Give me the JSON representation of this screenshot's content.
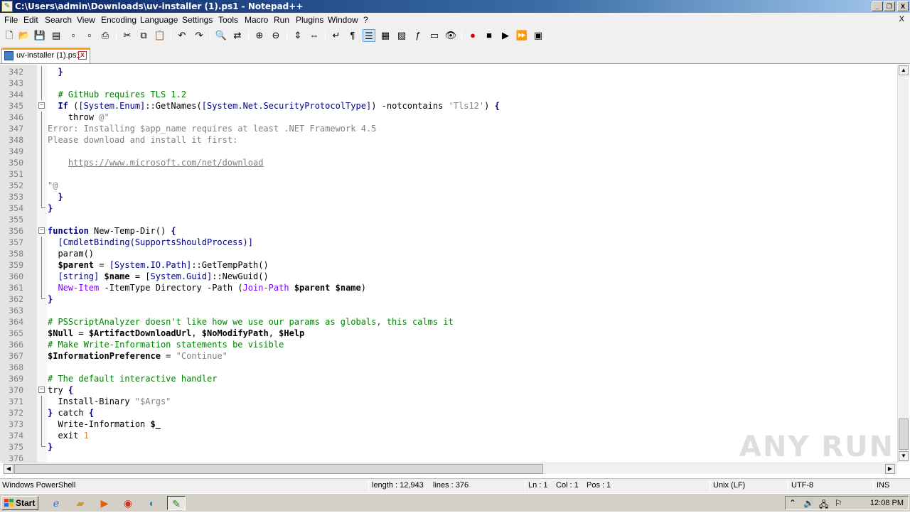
{
  "window": {
    "title": "C:\\Users\\admin\\Downloads\\uv-installer (1).ps1 - Notepad++",
    "min_label": "_",
    "max_label": "❐",
    "close_label": "X"
  },
  "menu": {
    "items": [
      "File",
      "Edit",
      "Search",
      "View",
      "Encoding",
      "Language",
      "Settings",
      "Tools",
      "Macro",
      "Run",
      "Plugins",
      "Window",
      "?"
    ],
    "close_label": "X"
  },
  "toolbar": {
    "icons": [
      "new-file-icon",
      "open-file-icon",
      "save-icon",
      "save-all-icon",
      "close-icon",
      "close-all-icon",
      "print-icon",
      "cut-icon",
      "copy-icon",
      "paste-icon",
      "undo-icon",
      "redo-icon",
      "find-icon",
      "replace-icon",
      "zoom-in-icon",
      "zoom-out-icon",
      "sync-vertical-icon",
      "sync-horizontal-icon",
      "word-wrap-icon",
      "show-all-chars-icon",
      "indent-guide-icon",
      "user-language-icon",
      "doc-map-icon",
      "function-list-icon",
      "folder-workspace-icon",
      "monitoring-icon",
      "record-macro-icon",
      "stop-macro-icon",
      "play-macro-icon",
      "run-macro-multiple-icon",
      "save-macro-icon"
    ]
  },
  "tab": {
    "label": "uv-installer (1).ps1",
    "close_label": "x"
  },
  "editor": {
    "lines": [
      {
        "n": "342",
        "fold": "line",
        "seg": [
          {
            "c": "plain",
            "t": "  "
          },
          {
            "c": "k",
            "t": "}"
          }
        ]
      },
      {
        "n": "343",
        "fold": "line",
        "seg": []
      },
      {
        "n": "344",
        "fold": "line",
        "seg": [
          {
            "c": "plain",
            "t": "  "
          },
          {
            "c": "cm",
            "t": "# GitHub requires TLS 1.2"
          }
        ]
      },
      {
        "n": "345",
        "fold": "box",
        "seg": [
          {
            "c": "plain",
            "t": "  "
          },
          {
            "c": "k",
            "t": "If"
          },
          {
            "c": "plain",
            "t": " ("
          },
          {
            "c": "typ",
            "t": "[System.Enum]"
          },
          {
            "c": "plain",
            "t": "::"
          },
          {
            "c": "plain",
            "t": "GetNames("
          },
          {
            "c": "typ",
            "t": "[System.Net.SecurityProtocolType]"
          },
          {
            "c": "plain",
            "t": ") -notcontains "
          },
          {
            "c": "str",
            "t": "'Tls12'"
          },
          {
            "c": "plain",
            "t": ") "
          },
          {
            "c": "k",
            "t": "{"
          }
        ]
      },
      {
        "n": "346",
        "fold": "line",
        "seg": [
          {
            "c": "plain",
            "t": "    throw "
          },
          {
            "c": "str",
            "t": "@\""
          }
        ]
      },
      {
        "n": "347",
        "fold": "line",
        "seg": [
          {
            "c": "str",
            "t": "Error: Installing $app_name requires at least .NET Framework 4.5"
          }
        ]
      },
      {
        "n": "348",
        "fold": "line",
        "seg": [
          {
            "c": "str",
            "t": "Please download and install it first:"
          }
        ]
      },
      {
        "n": "349",
        "fold": "line",
        "seg": []
      },
      {
        "n": "350",
        "fold": "line",
        "seg": [
          {
            "c": "str",
            "t": "    "
          },
          {
            "c": "link",
            "t": "https://www.microsoft.com/net/download"
          }
        ]
      },
      {
        "n": "351",
        "fold": "line",
        "seg": []
      },
      {
        "n": "352",
        "fold": "line",
        "seg": [
          {
            "c": "str",
            "t": "\"@"
          }
        ]
      },
      {
        "n": "353",
        "fold": "line",
        "seg": [
          {
            "c": "plain",
            "t": "  "
          },
          {
            "c": "k",
            "t": "}"
          }
        ]
      },
      {
        "n": "354",
        "fold": "end",
        "seg": [
          {
            "c": "k",
            "t": "}"
          }
        ]
      },
      {
        "n": "355",
        "fold": "none",
        "seg": []
      },
      {
        "n": "356",
        "fold": "box",
        "seg": [
          {
            "c": "k",
            "t": "function"
          },
          {
            "c": "plain",
            "t": " New-Temp-Dir() "
          },
          {
            "c": "k",
            "t": "{"
          }
        ]
      },
      {
        "n": "357",
        "fold": "line",
        "seg": [
          {
            "c": "plain",
            "t": "  "
          },
          {
            "c": "typ",
            "t": "[CmdletBinding(SupportsShouldProcess)]"
          }
        ]
      },
      {
        "n": "358",
        "fold": "line",
        "seg": [
          {
            "c": "plain",
            "t": "  param()"
          }
        ]
      },
      {
        "n": "359",
        "fold": "line",
        "seg": [
          {
            "c": "plain",
            "t": "  "
          },
          {
            "c": "var",
            "t": "$parent"
          },
          {
            "c": "plain",
            "t": " = "
          },
          {
            "c": "typ",
            "t": "[System.IO.Path]"
          },
          {
            "c": "plain",
            "t": "::GetTempPath()"
          }
        ]
      },
      {
        "n": "360",
        "fold": "line",
        "seg": [
          {
            "c": "plain",
            "t": "  "
          },
          {
            "c": "typ",
            "t": "[string]"
          },
          {
            "c": "plain",
            "t": " "
          },
          {
            "c": "var",
            "t": "$name"
          },
          {
            "c": "plain",
            "t": " = "
          },
          {
            "c": "typ",
            "t": "[System.Guid]"
          },
          {
            "c": "plain",
            "t": "::NewGuid()"
          }
        ]
      },
      {
        "n": "361",
        "fold": "line",
        "seg": [
          {
            "c": "plain",
            "t": "  "
          },
          {
            "c": "cmd",
            "t": "New-Item"
          },
          {
            "c": "plain",
            "t": " -ItemType Directory -Path ("
          },
          {
            "c": "cmd",
            "t": "Join-Path"
          },
          {
            "c": "plain",
            "t": " "
          },
          {
            "c": "var",
            "t": "$parent"
          },
          {
            "c": "plain",
            "t": " "
          },
          {
            "c": "var",
            "t": "$name"
          },
          {
            "c": "plain",
            "t": ")"
          }
        ]
      },
      {
        "n": "362",
        "fold": "end",
        "seg": [
          {
            "c": "k",
            "t": "}"
          }
        ]
      },
      {
        "n": "363",
        "fold": "none",
        "seg": []
      },
      {
        "n": "364",
        "fold": "none",
        "seg": [
          {
            "c": "cm",
            "t": "# PSScriptAnalyzer doesn't like how we use our params as globals, this calms it"
          }
        ]
      },
      {
        "n": "365",
        "fold": "none",
        "seg": [
          {
            "c": "var",
            "t": "$Null"
          },
          {
            "c": "plain",
            "t": " = "
          },
          {
            "c": "var",
            "t": "$ArtifactDownloadUrl"
          },
          {
            "c": "plain",
            "t": ", "
          },
          {
            "c": "var",
            "t": "$NoModifyPath"
          },
          {
            "c": "plain",
            "t": ", "
          },
          {
            "c": "var",
            "t": "$Help"
          }
        ]
      },
      {
        "n": "366",
        "fold": "none",
        "seg": [
          {
            "c": "cm",
            "t": "# Make Write-Information statements be visible"
          }
        ]
      },
      {
        "n": "367",
        "fold": "none",
        "seg": [
          {
            "c": "var",
            "t": "$InformationPreference"
          },
          {
            "c": "plain",
            "t": " = "
          },
          {
            "c": "str",
            "t": "\"Continue\""
          }
        ]
      },
      {
        "n": "368",
        "fold": "none",
        "seg": []
      },
      {
        "n": "369",
        "fold": "none",
        "seg": [
          {
            "c": "cm",
            "t": "# The default interactive handler"
          }
        ]
      },
      {
        "n": "370",
        "fold": "box",
        "seg": [
          {
            "c": "plain",
            "t": "try "
          },
          {
            "c": "k",
            "t": "{"
          }
        ]
      },
      {
        "n": "371",
        "fold": "line",
        "seg": [
          {
            "c": "plain",
            "t": "  Install-Binary "
          },
          {
            "c": "str",
            "t": "\"$Args\""
          }
        ]
      },
      {
        "n": "372",
        "fold": "line",
        "seg": [
          {
            "c": "k",
            "t": "}"
          },
          {
            "c": "plain",
            "t": " catch "
          },
          {
            "c": "k",
            "t": "{"
          }
        ]
      },
      {
        "n": "373",
        "fold": "line",
        "seg": [
          {
            "c": "plain",
            "t": "  Write-Information "
          },
          {
            "c": "var",
            "t": "$_"
          }
        ]
      },
      {
        "n": "374",
        "fold": "line",
        "seg": [
          {
            "c": "plain",
            "t": "  exit "
          },
          {
            "c": "num",
            "t": "1"
          }
        ]
      },
      {
        "n": "375",
        "fold": "end",
        "seg": [
          {
            "c": "k",
            "t": "}"
          }
        ]
      },
      {
        "n": "376",
        "fold": "none",
        "seg": []
      }
    ]
  },
  "scroll": {
    "up_label": "▲",
    "down_label": "▼",
    "left_label": "◀",
    "right_label": "▶"
  },
  "status": {
    "language": "Windows PowerShell",
    "length": "length : 12,943",
    "lines": "lines : 376",
    "ln": "Ln : 1",
    "col": "Col : 1",
    "pos": "Pos : 1",
    "eol": "Unix (LF)",
    "encoding": "UTF-8",
    "mode": "INS"
  },
  "taskbar": {
    "start_label": "Start",
    "apps": [
      "internet-explorer-icon",
      "file-explorer-icon",
      "media-player-icon",
      "chrome-icon",
      "edge-icon",
      "notepad-plus-plus-icon"
    ],
    "clock": "12:08 PM"
  },
  "watermark": "ANY RUN"
}
